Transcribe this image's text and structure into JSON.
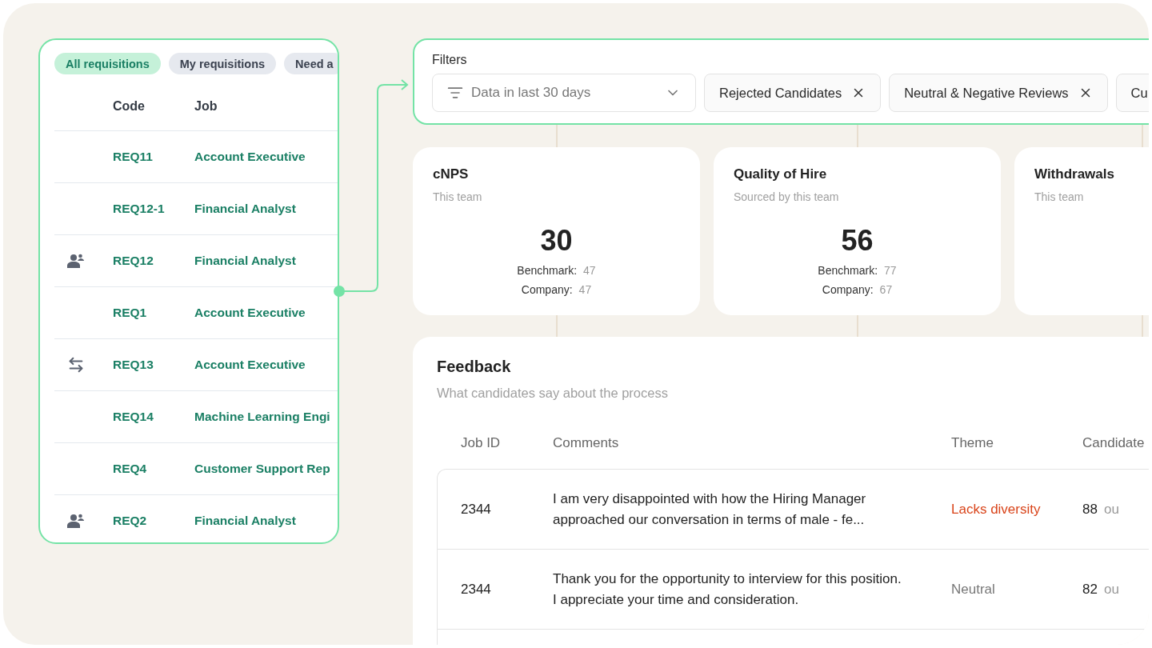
{
  "requisitions": {
    "tabs": [
      {
        "label": "All requisitions",
        "selected": true
      },
      {
        "label": "My requisitions",
        "selected": false
      },
      {
        "label": "Need a",
        "selected": false
      }
    ],
    "columns": [
      "Code",
      "Job"
    ],
    "rows": [
      {
        "kind": "plain",
        "code": "REQ11",
        "job": "Account Executive"
      },
      {
        "kind": "plain",
        "code": "REQ12-1",
        "job": "Financial Analyst"
      },
      {
        "kind": "shared",
        "code": "REQ12",
        "job": "Financial Analyst"
      },
      {
        "kind": "plain",
        "code": "REQ1",
        "job": "Account Executive"
      },
      {
        "kind": "transferred",
        "code": "REQ13",
        "job": "Account Executive"
      },
      {
        "kind": "plain",
        "code": "REQ14",
        "job": "Machine Learning Engi"
      },
      {
        "kind": "plain",
        "code": "REQ4",
        "job": "Customer Support Rep"
      },
      {
        "kind": "shared",
        "code": "REQ2",
        "job": "Financial Analyst"
      }
    ]
  },
  "filters": {
    "title": "Filters",
    "period": {
      "value": "Data in last 30 days"
    },
    "chips": [
      {
        "label": "Rejected Candidates",
        "removable": true
      },
      {
        "label": "Neutral & Negative Reviews",
        "removable": true
      },
      {
        "label": "Cu",
        "removable": false
      }
    ]
  },
  "metrics": [
    {
      "title": "cNPS",
      "subtitle": "This team",
      "value": "30",
      "lines": [
        {
          "label": "Benchmark:",
          "value": "47"
        },
        {
          "label": "Company:",
          "value": "47"
        }
      ]
    },
    {
      "title": "Quality of Hire",
      "subtitle": "Sourced by this team",
      "value": "56",
      "lines": [
        {
          "label": "Benchmark:",
          "value": "77"
        },
        {
          "label": "Company:",
          "value": "67"
        }
      ]
    },
    {
      "title": "Withdrawals",
      "subtitle": "This team"
    }
  ],
  "feedback": {
    "title": "Feedback",
    "subtitle": "What candidates say about the process",
    "columns": [
      "Job ID",
      "Comments",
      "Theme",
      "Candidate"
    ],
    "rows": [
      {
        "job_id": "2344",
        "comment": "I am very disappointed with how the Hiring Manager\napproached our conversation in terms of male - fe...",
        "theme": "Lacks diversity",
        "kind": "negative",
        "score": "88",
        "suffix": "ou"
      },
      {
        "job_id": "2344",
        "comment": "Thank you for the opportunity to interview for this position.\nI appreciate your time and consideration.",
        "theme": "Neutral",
        "kind": "neutral",
        "score": "82",
        "suffix": "ou"
      }
    ]
  }
}
